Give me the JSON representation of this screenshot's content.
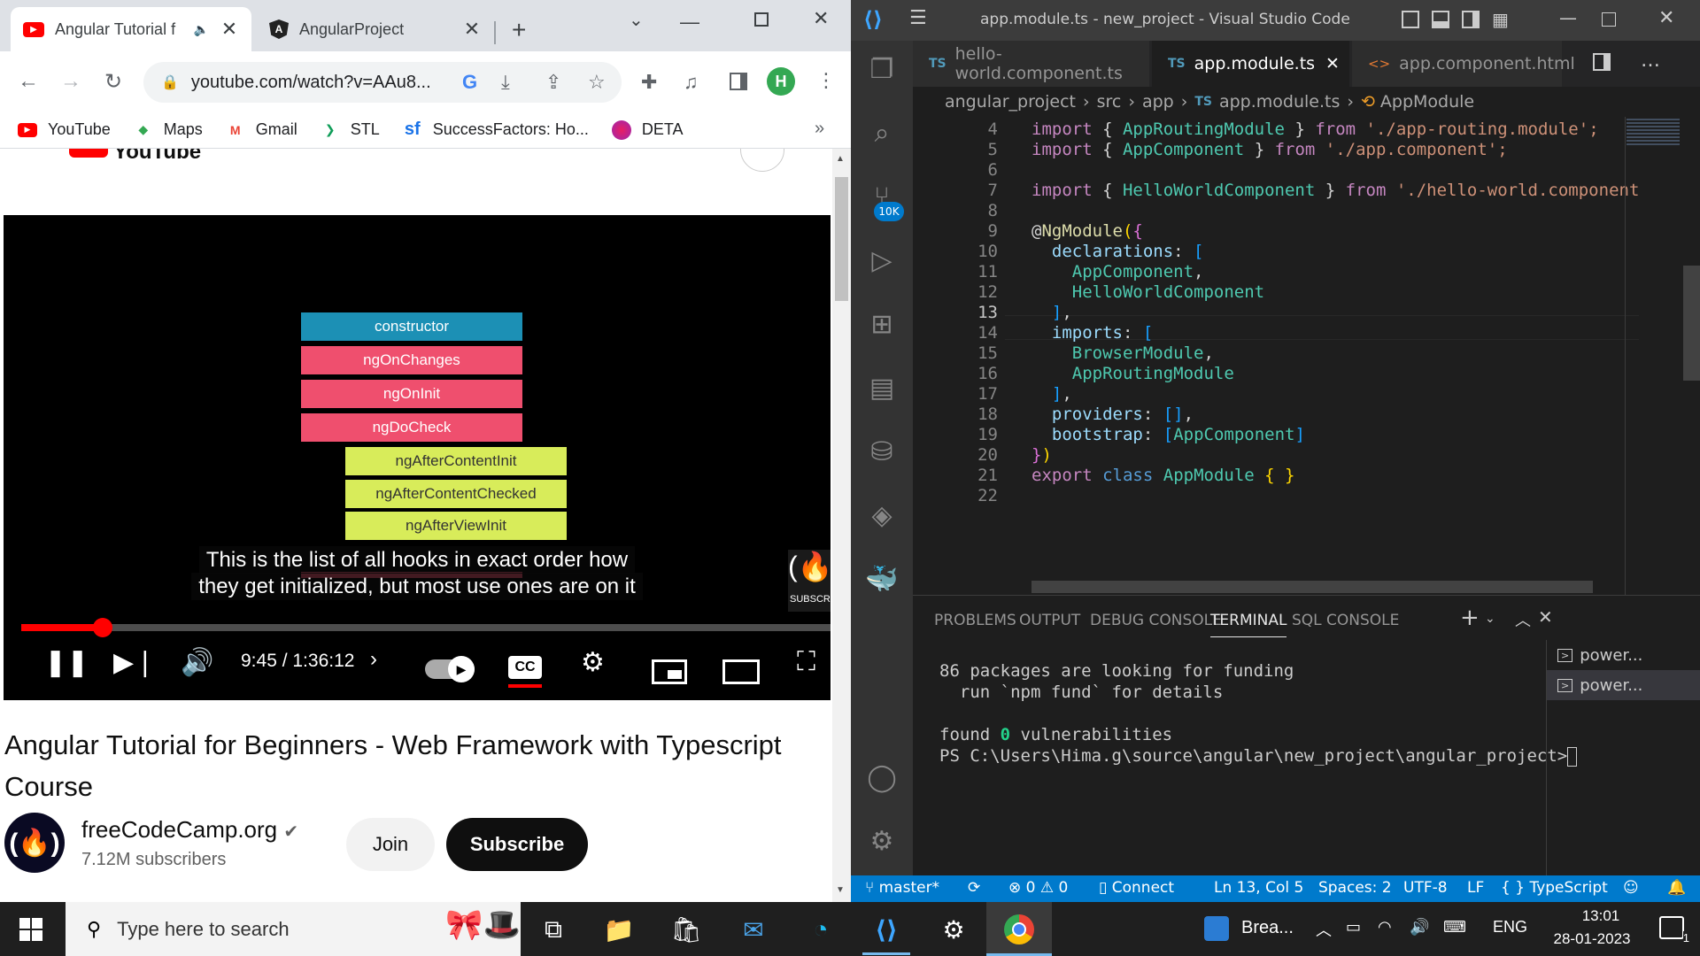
{
  "chrome": {
    "tabs": [
      {
        "title": "Angular Tutorial f",
        "icon": "youtube-icon",
        "audio": true
      },
      {
        "title": "AngularProject",
        "icon": "angular-icon"
      }
    ],
    "url": "youtube.com/watch?v=AAu8...",
    "profile_initial": "H",
    "bookmarks": [
      {
        "label": "YouTube",
        "icon": "youtube-icon"
      },
      {
        "label": "Maps",
        "icon": "maps-icon"
      },
      {
        "label": "Gmail",
        "icon": "gmail-icon"
      },
      {
        "label": "STL",
        "icon": "stl-icon"
      },
      {
        "label": "SuccessFactors: Ho...",
        "icon": "sf-icon"
      },
      {
        "label": "DETA",
        "icon": "deta-icon"
      }
    ],
    "bookmarks_more": "»",
    "header_partial": "YouTube"
  },
  "video": {
    "hooks": [
      {
        "label": "constructor",
        "color": "#1c90b5"
      },
      {
        "label": "ngOnChanges",
        "color": "#ef4f6e"
      },
      {
        "label": "ngOnInit",
        "color": "#ef4f6e"
      },
      {
        "label": "ngDoCheck",
        "color": "#ef4f6e"
      },
      {
        "label": "ngAfterContentInit",
        "color": "#d8ec5a"
      },
      {
        "label": "ngAfterContentChecked",
        "color": "#d8ec5a"
      },
      {
        "label": "ngAfterViewInit",
        "color": "#d8ec5a"
      }
    ],
    "captions": [
      "This is the list of all hooks in exact order how",
      "they get initialized, but most use ones are on it"
    ],
    "watermark": "SUBSCR",
    "time": "9:45 / 1:36:12",
    "progress": 0.101,
    "title": "Angular Tutorial for Beginners - Web Framework with Typescript Course",
    "channel": "freeCodeCamp.org",
    "subscribers": "7.12M subscribers",
    "join": "Join",
    "subscribe": "Subscribe"
  },
  "vscode": {
    "window_title": "app.module.ts - new_project - Visual Studio Code",
    "tabs": [
      {
        "label": "hello-world.component.ts",
        "kind": "TS"
      },
      {
        "label": "app.module.ts",
        "kind": "TS",
        "active": true
      },
      {
        "label": "app.component.html",
        "kind": "<>"
      }
    ],
    "breadcrumb": [
      "angular_project",
      "src",
      "app",
      "app.module.ts",
      "AppModule"
    ],
    "source_control_badge": "10K",
    "code_lines": [
      {
        "n": "4"
      },
      {
        "n": "5"
      },
      {
        "n": "6"
      },
      {
        "n": "7"
      },
      {
        "n": "8"
      },
      {
        "n": "9"
      },
      {
        "n": "10"
      },
      {
        "n": "11"
      },
      {
        "n": "12"
      },
      {
        "n": "13"
      },
      {
        "n": "14"
      },
      {
        "n": "15"
      },
      {
        "n": "16"
      },
      {
        "n": "17"
      },
      {
        "n": "18"
      },
      {
        "n": "19"
      },
      {
        "n": "20"
      },
      {
        "n": "21"
      },
      {
        "n": "22"
      }
    ],
    "code_text": {
      "l4": [
        "import",
        " { ",
        "AppRoutingModule",
        " } ",
        "from",
        " './app-routing.module';"
      ],
      "l5": [
        "import",
        " { ",
        "AppComponent",
        " } ",
        "from",
        " './app.component';"
      ],
      "l7": [
        "import",
        " { ",
        "HelloWorldComponent",
        " } ",
        "from",
        " './hello-world.component"
      ],
      "l9": [
        "@",
        "NgModule",
        "(",
        "{"
      ],
      "l10": [
        "  declarations",
        ": ",
        "["
      ],
      "l11": [
        "    AppComponent",
        ","
      ],
      "l12": [
        "    HelloWorldComponent"
      ],
      "l13": [
        "  ",
        "]",
        ","
      ],
      "l14": [
        "  imports",
        ": ",
        "["
      ],
      "l15": [
        "    BrowserModule",
        ","
      ],
      "l16": [
        "    AppRoutingModule"
      ],
      "l17": [
        "  ",
        "]",
        ","
      ],
      "l18": [
        "  providers",
        ": ",
        "[]",
        ","
      ],
      "l19": [
        "  bootstrap",
        ": ",
        "[",
        "AppComponent",
        "]"
      ],
      "l20": [
        "}",
        ")"
      ],
      "l21": [
        "export",
        " ",
        "class",
        " ",
        "AppModule",
        " { }"
      ]
    },
    "panel_tabs": [
      "PROBLEMS",
      "OUTPUT",
      "DEBUG CONSOLE",
      "TERMINAL",
      "SQL CONSOLE"
    ],
    "terminal": [
      "86 packages are looking for funding",
      "  run `npm fund` for details",
      "",
      "found 0 vulnerabilities",
      "PS C:\\Users\\Hima.g\\source\\angular\\new_project\\angular_project>"
    ],
    "terminal_found_parts": [
      "found ",
      "0",
      " vulnerabilities"
    ],
    "terminal_list": [
      "power...",
      "power..."
    ],
    "status": {
      "branch": "master*",
      "errors": "0",
      "warnings": "0",
      "connect": "Connect",
      "position": "Ln 13, Col 5",
      "spaces": "Spaces: 2",
      "encoding": "UTF-8",
      "eol": "LF",
      "language": "TypeScript",
      "braces": "{ }"
    }
  },
  "taskbar": {
    "search_placeholder": "Type here to search",
    "weather_app": "Brea...",
    "language": "ENG",
    "time": "13:01",
    "date": "28-01-2023",
    "notifications": "1"
  }
}
